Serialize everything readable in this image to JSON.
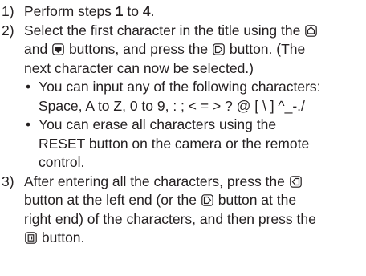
{
  "steps": [
    {
      "number": "1)",
      "text_before": "Perform steps ",
      "bold1": "1",
      "text_mid": " to ",
      "bold2": "4",
      "text_after": "."
    },
    {
      "number": "2)",
      "line1": "Select the first character in the title using the",
      "line2_a": "and",
      "line2_b": "buttons, and press the",
      "line2_c": "button. (The",
      "line3": "next character can now be selected.)",
      "bullets": [
        {
          "dot": "•",
          "line1": "You can input any of the following characters:",
          "line2": "Space, A to Z, 0 to 9, : ; < = > ? @ [ \\ ] ^_-./"
        },
        {
          "dot": "•",
          "line1": "You can erase all characters using the",
          "line2": "RESET button on the camera or the remote",
          "line3": "control."
        }
      ]
    },
    {
      "number": "3)",
      "line1": "After entering all the characters, press the",
      "line2_a": "button at the left end (or the",
      "line2_b": "button at the",
      "line3": "right end) of the characters, and then press the",
      "line4": "button."
    }
  ],
  "icons": {
    "up": "up-button-icon",
    "down": "down-button-icon",
    "right": "right-button-icon",
    "left": "left-button-icon",
    "set": "set-button-icon"
  }
}
